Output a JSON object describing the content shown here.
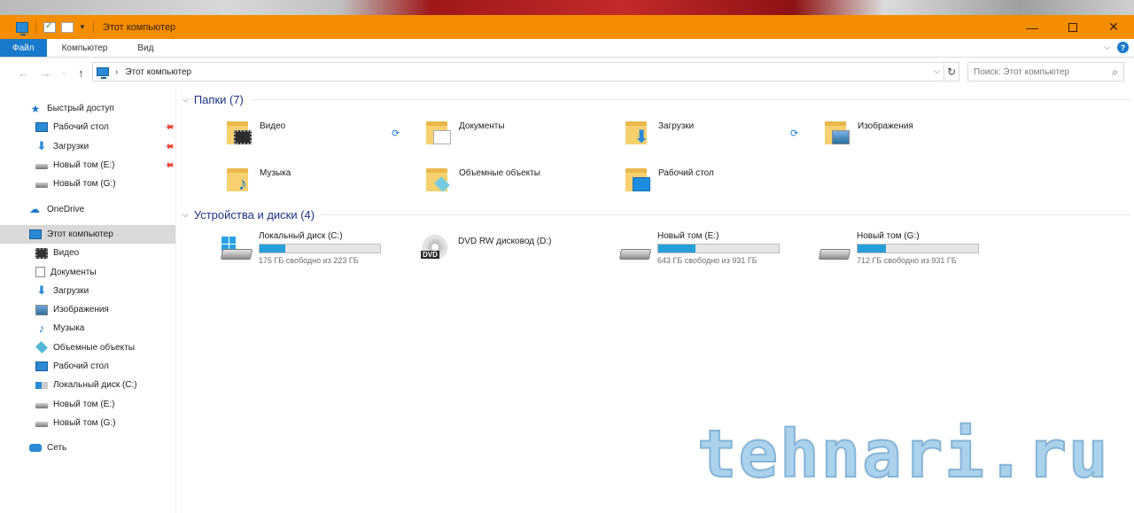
{
  "window": {
    "title": "Этот компьютер",
    "accent_color": "#f58d00"
  },
  "ribbon": {
    "tabs": [
      {
        "label": "Файл"
      },
      {
        "label": "Компьютер"
      },
      {
        "label": "Вид"
      }
    ]
  },
  "address": {
    "crumb": "Этот компьютер",
    "search_placeholder": "Поиск: Этот компьютер"
  },
  "sidebar": {
    "quick_access": "Быстрый доступ",
    "quick_items": [
      {
        "label": "Рабочий стол",
        "icon": "desktop-icon",
        "pinned": true
      },
      {
        "label": "Загрузки",
        "icon": "downloads-icon",
        "pinned": true
      },
      {
        "label": "Новый том (E:)",
        "icon": "drive-icon",
        "pinned": true
      },
      {
        "label": "Новый том (G:)",
        "icon": "drive-icon",
        "pinned": false
      }
    ],
    "onedrive": "OneDrive",
    "this_pc": "Этот компьютер",
    "pc_items": [
      {
        "label": "Видео",
        "icon": "video-icon"
      },
      {
        "label": "Документы",
        "icon": "documents-icon"
      },
      {
        "label": "Загрузки",
        "icon": "downloads-icon"
      },
      {
        "label": "Изображения",
        "icon": "pictures-icon"
      },
      {
        "label": "Музыка",
        "icon": "music-icon"
      },
      {
        "label": "Объемные объекты",
        "icon": "3d-objects-icon"
      },
      {
        "label": "Рабочий стол",
        "icon": "desktop-icon"
      },
      {
        "label": "Локальный диск (C:)",
        "icon": "windows-drive-icon"
      },
      {
        "label": "Новый том (E:)",
        "icon": "drive-icon"
      },
      {
        "label": "Новый том (G:)",
        "icon": "drive-icon"
      }
    ],
    "network": "Сеть"
  },
  "main": {
    "folders_header": "Папки (7)",
    "folders": [
      {
        "label": "Видео",
        "icon": "video-folder-icon"
      },
      {
        "label": "Документы",
        "icon": "documents-folder-icon"
      },
      {
        "label": "Загрузки",
        "icon": "downloads-folder-icon"
      },
      {
        "label": "Изображения",
        "icon": "pictures-folder-icon"
      },
      {
        "label": "Музыка",
        "icon": "music-folder-icon"
      },
      {
        "label": "Объемные объекты",
        "icon": "3d-objects-folder-icon"
      },
      {
        "label": "Рабочий стол",
        "icon": "desktop-folder-icon"
      }
    ],
    "devices_header": "Устройства и диски (4)",
    "drives": [
      {
        "label": "Локальный диск (C:)",
        "free": "175 ГБ свободно из 223 ГБ",
        "used_fraction": 0.215,
        "icon": "windows-drive-icon"
      },
      {
        "label": "DVD RW дисковод (D:)",
        "icon": "dvd-drive-icon"
      },
      {
        "label": "Новый том (E:)",
        "free": "643 ГБ свободно из 931 ГБ",
        "used_fraction": 0.309,
        "icon": "drive-icon"
      },
      {
        "label": "Новый том (G:)",
        "free": "712 ГБ свободно из 931 ГБ",
        "used_fraction": 0.235,
        "icon": "drive-icon"
      }
    ],
    "bar_color": "#26a0da"
  },
  "watermark": "tehnari.ru"
}
